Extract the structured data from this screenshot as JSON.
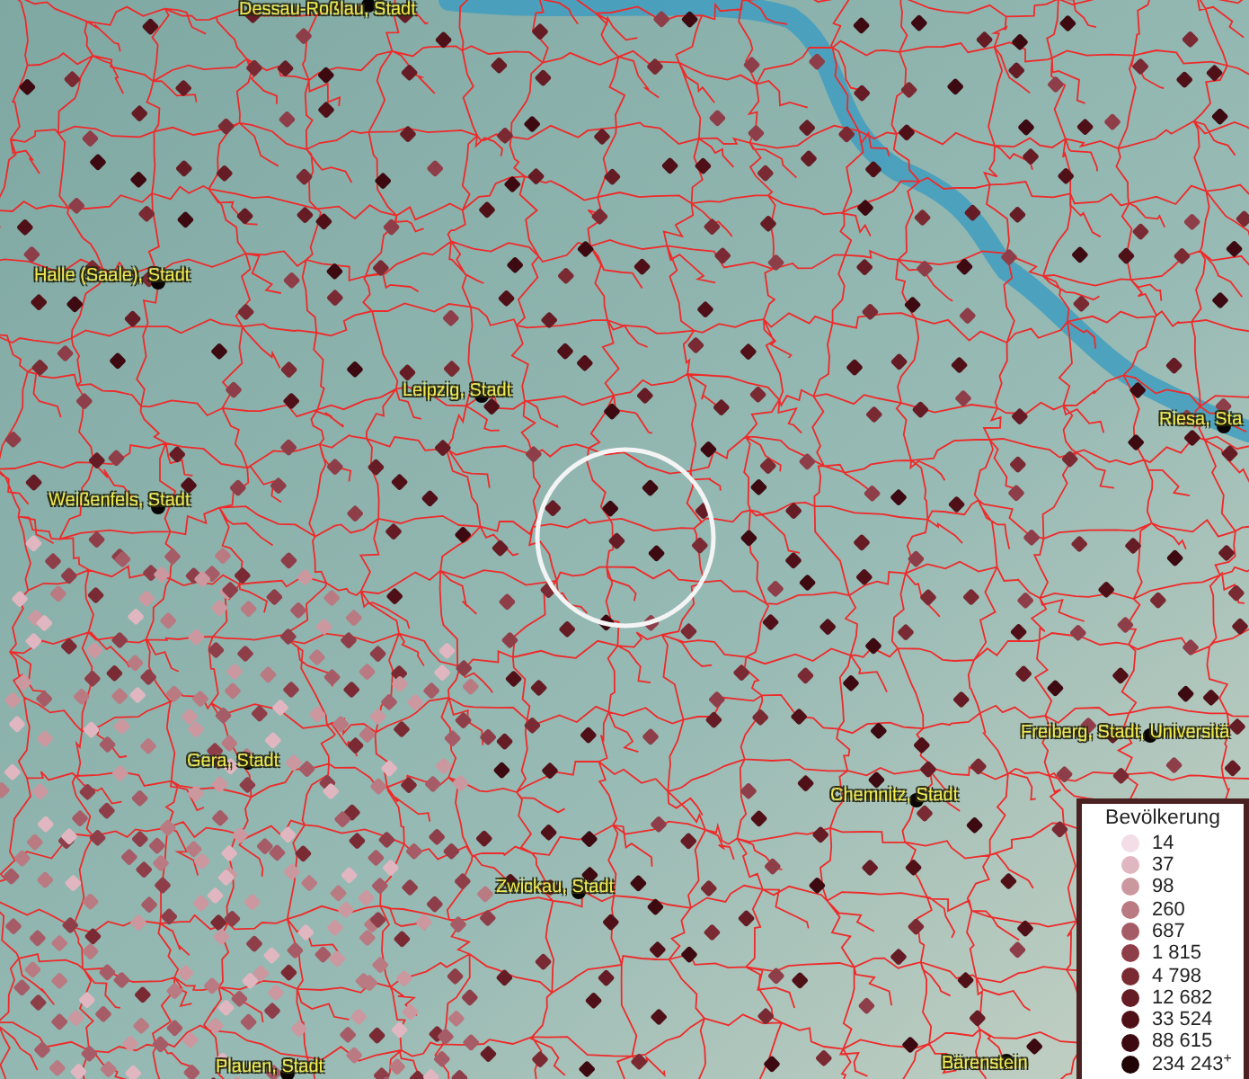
{
  "map": {
    "places": [
      {
        "label": "Dessau-Roßlau, Stadt"
      },
      {
        "label": "Halle (Saale), Stadt"
      },
      {
        "label": "Leipzig, Stadt"
      },
      {
        "label": "Weißenfels, Stadt"
      },
      {
        "label": "Riesa, Sta"
      },
      {
        "label": "Freiberg, Stadt, Universitä"
      },
      {
        "label": "Gera, Stadt"
      },
      {
        "label": "Chemnitz, Stadt"
      },
      {
        "label": "Zwickau, Stadt"
      },
      {
        "label": "Plauen, Stadt"
      },
      {
        "label": "Bärenstein"
      }
    ]
  },
  "legend": {
    "title": "Bevölkerung",
    "entries": [
      {
        "label": "14",
        "color": "#f3dde6"
      },
      {
        "label": "37",
        "color": "#e0b7c0"
      },
      {
        "label": "98",
        "color": "#cc98a0"
      },
      {
        "label": "260",
        "color": "#b97a82"
      },
      {
        "label": "687",
        "color": "#a65c66"
      },
      {
        "label": "1 815",
        "color": "#8e3e48"
      },
      {
        "label": "4 798",
        "color": "#7a2a33"
      },
      {
        "label": "12 682",
        "color": "#651c24"
      },
      {
        "label": "33 524",
        "color": "#501018"
      },
      {
        "label": "88 615",
        "color": "#3c0a10"
      },
      {
        "label": "234 243$^{+}$",
        "color": "#200406"
      }
    ]
  }
}
